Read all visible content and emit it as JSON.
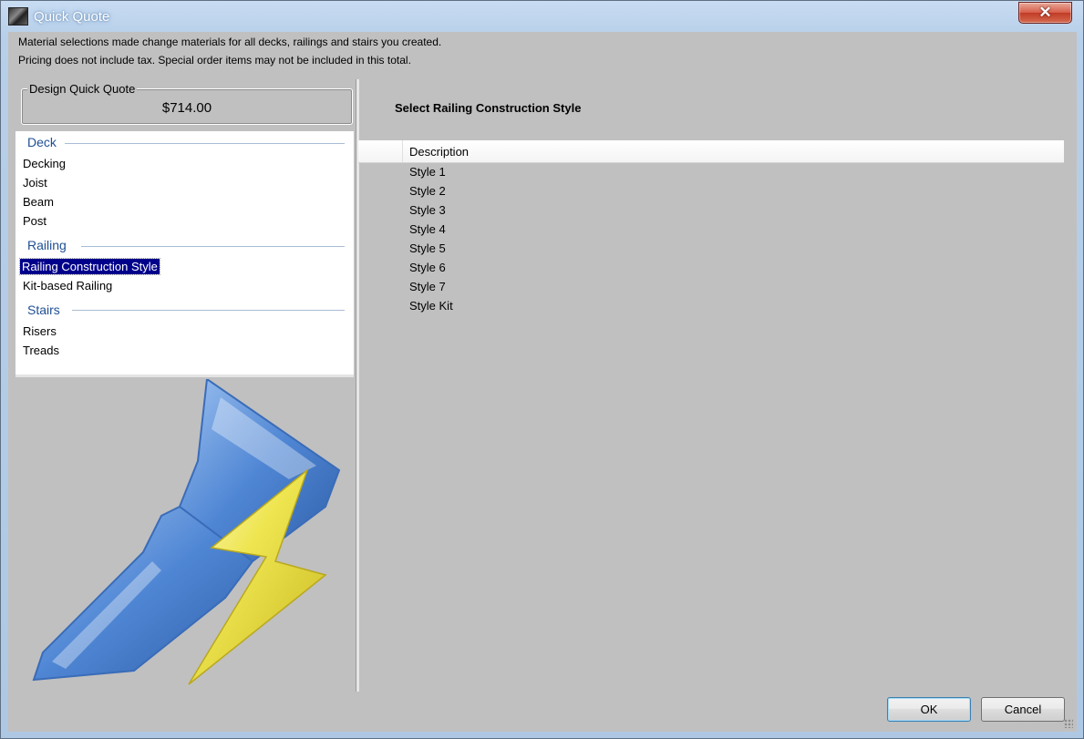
{
  "window": {
    "title": "Quick Quote",
    "close_symbol": "✕"
  },
  "info": {
    "line1": "Material selections made change materials for all decks, railings and stairs you created.",
    "line2": "Pricing does not include tax. Special order items may not be included in this total."
  },
  "quote": {
    "legend": "Design Quick Quote",
    "price": "$714.00"
  },
  "nav": {
    "deck_header": "Deck",
    "deck_items": [
      "Decking",
      "Joist",
      "Beam",
      "Post"
    ],
    "railing_header": "Railing",
    "railing_items": [
      "Railing Construction Style",
      "Kit-based Railing"
    ],
    "stairs_header": "Stairs",
    "stairs_items": [
      "Risers",
      "Treads"
    ],
    "selected": "Railing Construction Style"
  },
  "main": {
    "heading": "Select Railing Construction Style",
    "column_header": "Description",
    "rows": [
      "Style 1",
      "Style 2",
      "Style 3",
      "Style 4",
      "Style 5",
      "Style 6",
      "Style 7",
      "Style Kit"
    ]
  },
  "buttons": {
    "ok": "OK",
    "cancel": "Cancel"
  },
  "icons": [
    "app-icon",
    "close-icon",
    "paintbrush-lightning-icon",
    "resize-grip-icon"
  ],
  "colors": {
    "selection": "#00008b",
    "nav_header": "#1f4f94",
    "brush_blue": "#4f86d4",
    "lightning_yellow": "#e8e040"
  }
}
